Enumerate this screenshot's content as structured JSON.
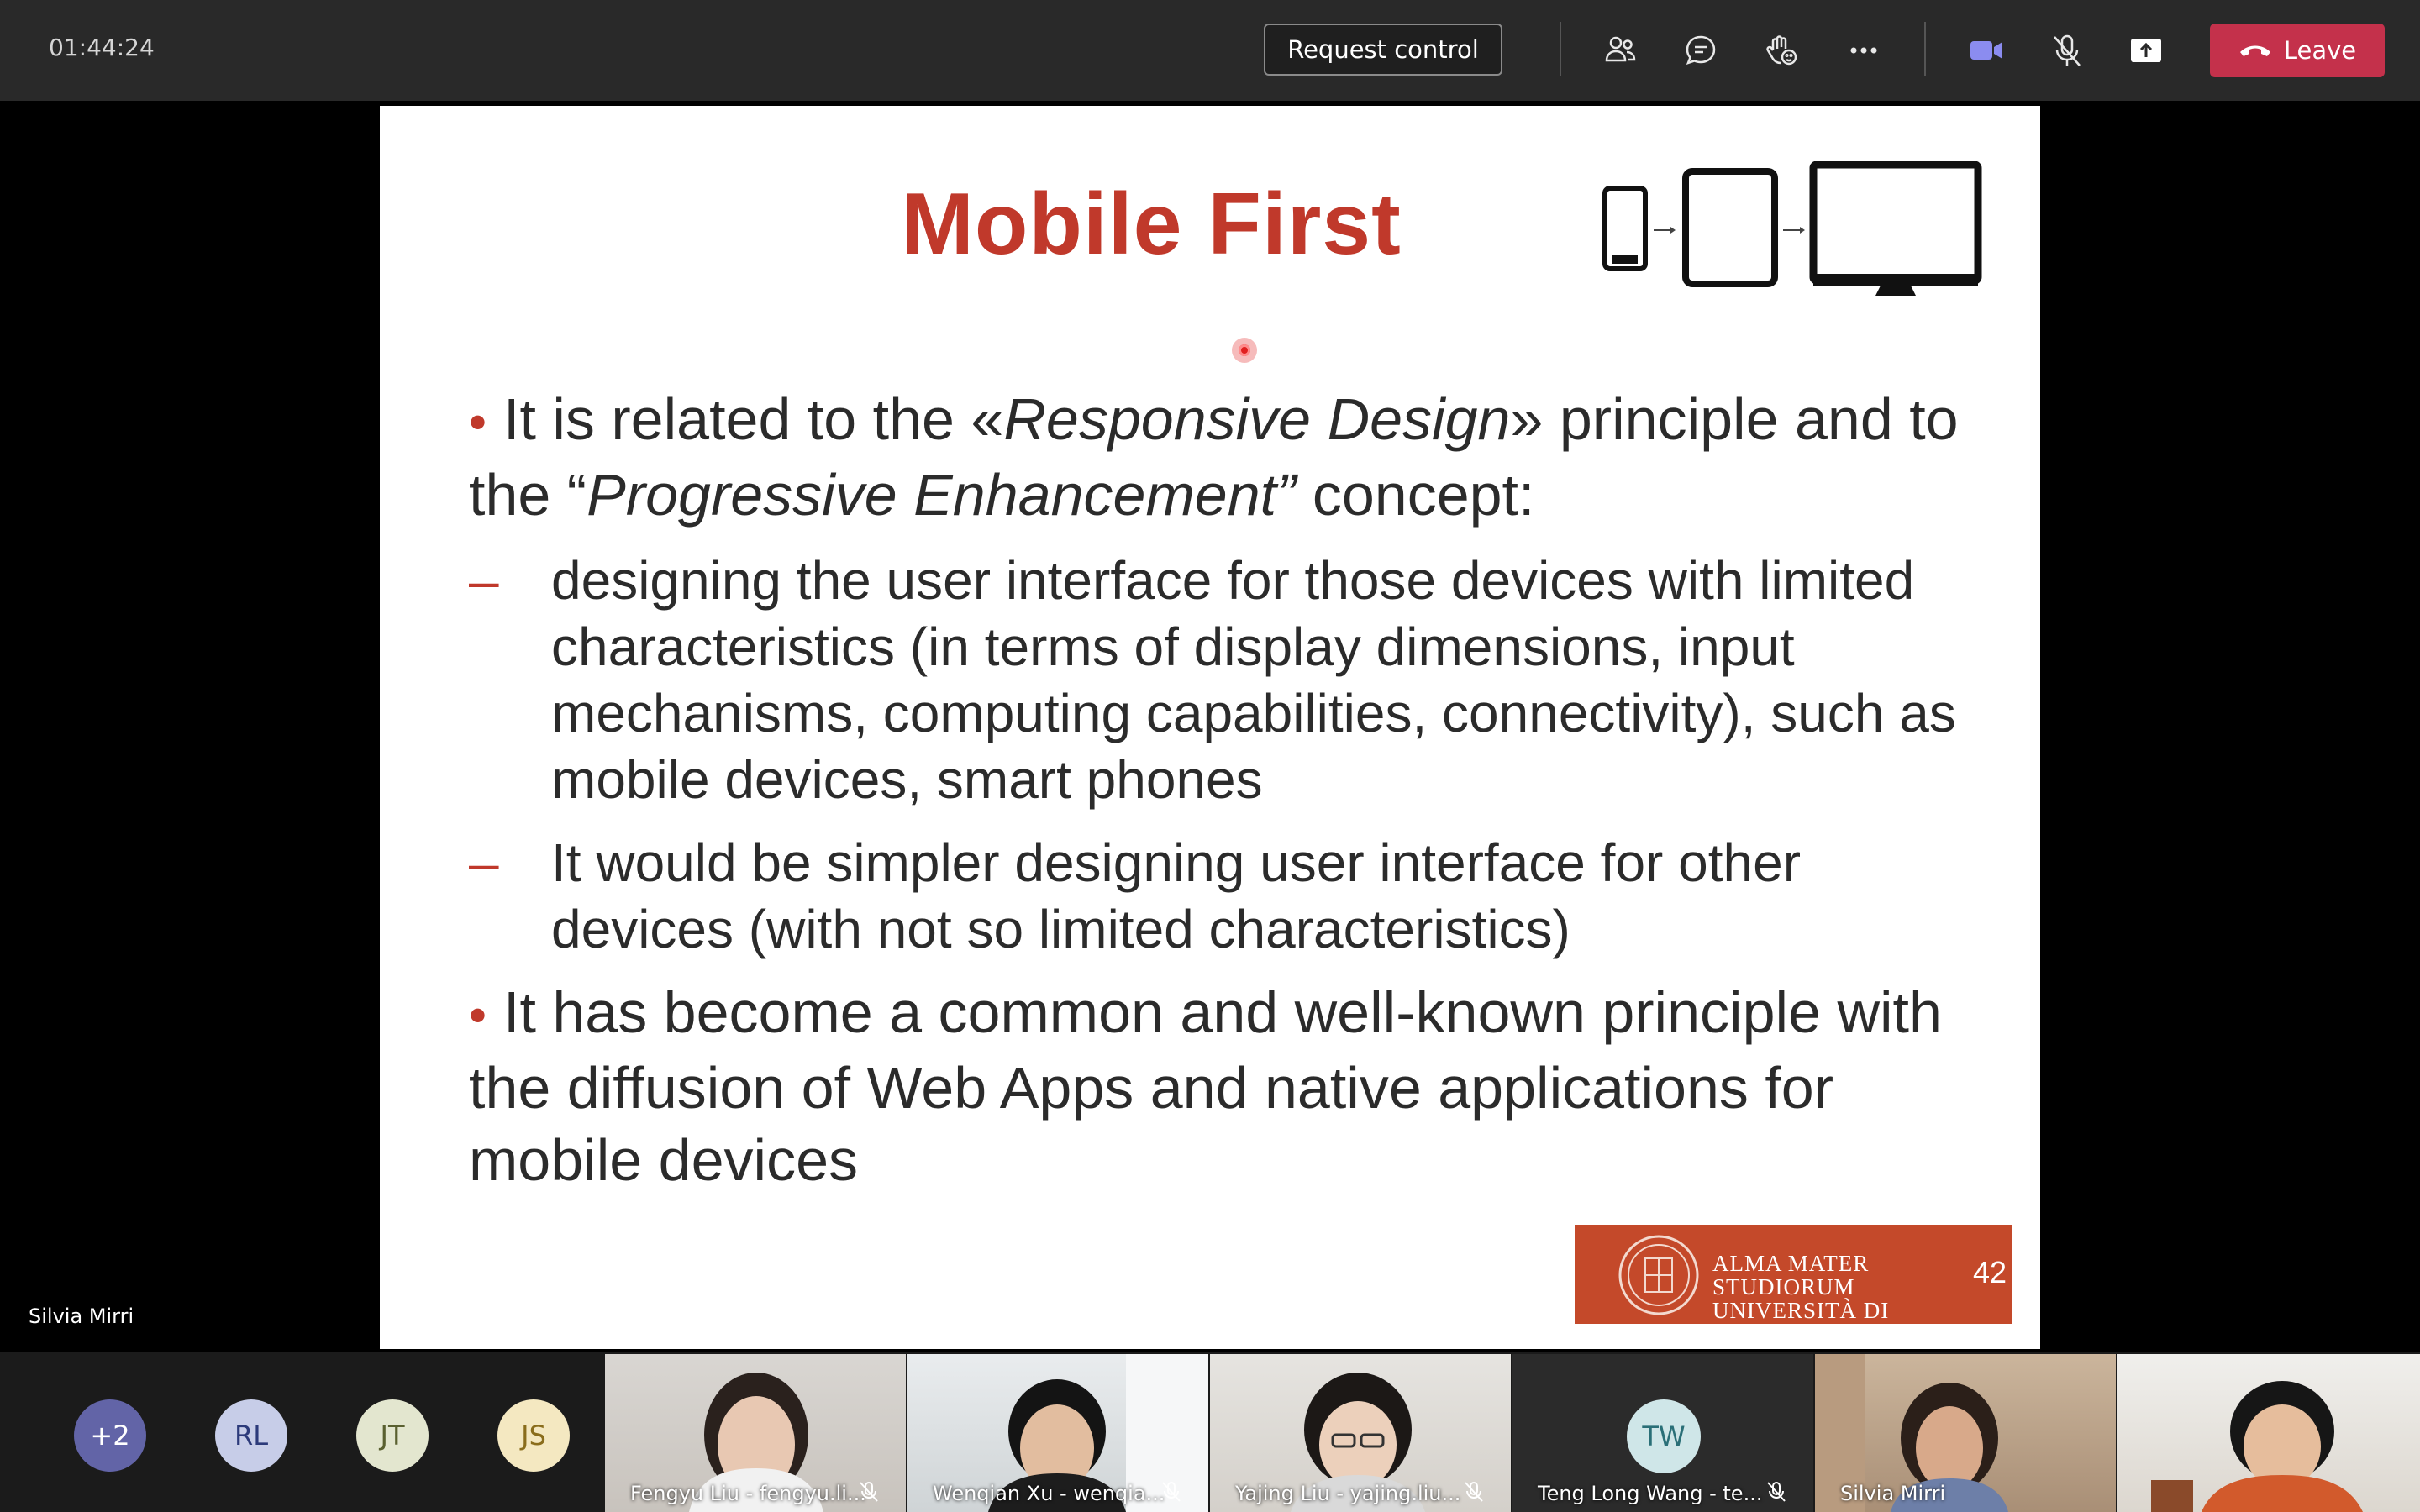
{
  "topbar": {
    "timer": "01:44:24",
    "request_control": "Request control",
    "leave": "Leave",
    "icons": [
      "participants-icon",
      "chat-icon",
      "raise-hand-icon",
      "more-icon",
      "camera-icon",
      "mic-off-icon",
      "share-icon",
      "hangup-icon"
    ],
    "accent": "#c4314b"
  },
  "stage": {
    "presenter": "Silvia Mirri"
  },
  "slide": {
    "title": "Mobile First",
    "bullet1_pre": "It is related to the «",
    "bullet1_em1": "Responsive Design",
    "bullet1_mid": "» principle and to the “",
    "bullet1_em2": "Progressive Enhancement”",
    "bullet1_post": " concept:",
    "sub1": "designing the user interface for those devices with limited characteristics (in terms of display dimensions, input mechanisms, computing capabilities, connectivity), such as mobile devices, smart phones",
    "sub2": "It would be simpler designing user interface for other devices (with not so limited characteristics)",
    "bullet2": "It has become a common and well-known principle with the diffusion of Web Apps and native applications for mobile devices",
    "logo_line1": "ALMA MATER STUDIORUM",
    "logo_line2": "UNIVERSITÀ DI BOLOGNA",
    "page_number": "42",
    "title_color": "#c0392b"
  },
  "participants": {
    "avatars": [
      {
        "initials": "+2",
        "bg": "#6264a7",
        "fg": "#ffffff"
      },
      {
        "initials": "RL",
        "bg": "#c7cde8",
        "fg": "#2c3a7a"
      },
      {
        "initials": "JT",
        "bg": "#e3e6cf",
        "fg": "#5a6030"
      },
      {
        "initials": "JS",
        "bg": "#f4e8c1",
        "fg": "#8a6d1c"
      }
    ],
    "tiles": [
      {
        "name": "Fengyu Liu - fengyu.li..."
      },
      {
        "name": "Wenqian Xu - wenqia..."
      },
      {
        "name": "Yajing Liu - yajing.liu..."
      },
      {
        "name": "Teng Long Wang - te...",
        "initials": "TW"
      },
      {
        "name": "Silvia Mirri"
      },
      {
        "name": ""
      }
    ]
  }
}
